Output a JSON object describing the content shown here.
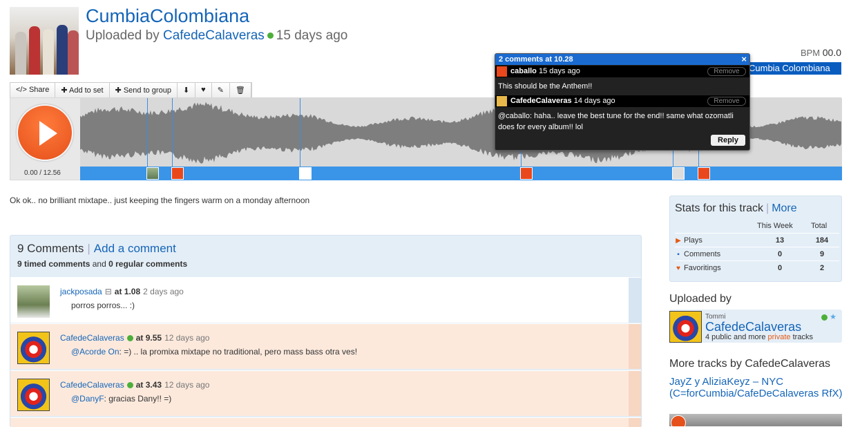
{
  "track": {
    "title": "CumbiaColombiana",
    "uploaded_prefix": "Uploaded by",
    "uploader": "CafedeCalaveras",
    "age": "15 days ago",
    "bpm_label": "BPM",
    "bpm_value": "00.0",
    "tag": "Cumbia Colombiana",
    "description": "Ok ok.. no brilliant mixtape.. just keeping the fingers warm on a monday afternoon"
  },
  "toolbar": {
    "share": "Share",
    "add_to_set": "Add to set",
    "send_to_group": "Send to group",
    "download_icon": "download-icon",
    "favorite_icon": "heart-icon",
    "edit_icon": "pencil-icon",
    "delete_icon": "trash-icon"
  },
  "player": {
    "time": "0.00 / 12.56",
    "played_fraction": 0,
    "markers": [
      0.088,
      0.121,
      0.288,
      0.578,
      0.778,
      0.811
    ]
  },
  "popup": {
    "header": "2 comments at 10.28",
    "close": "×",
    "remove_label": "Remove",
    "reply_label": "Reply",
    "items": [
      {
        "user": "caballo",
        "age": "15 days ago",
        "text": "This should be the Anthem!!"
      },
      {
        "user": "CafedeCalaveras",
        "age": "14 days ago",
        "text": "@caballo: haha.. leave the best tune for the end!! same what ozomatli does for every album!! lol"
      }
    ]
  },
  "comments": {
    "count_label": "9 Comments",
    "add_label": "Add a comment",
    "timed_count": "9 timed comments",
    "and_text": "and",
    "regular_count": "0 regular comments",
    "items": [
      {
        "user": "jackposada",
        "at_label": "at 1.08",
        "age": "2 days ago",
        "mention": "",
        "text": "porros porros... :)"
      },
      {
        "user": "CafedeCalaveras",
        "at_label": "at 9.55",
        "age": "12 days ago",
        "mention": "@Acorde On",
        "text": ": =) .. la promixa mixtape no traditional, pero mass bass otra ves!"
      },
      {
        "user": "CafedeCalaveras",
        "at_label": "at 3.43",
        "age": "12 days ago",
        "mention": "@DanyF",
        "text": ": gracias Dany!! =)"
      }
    ]
  },
  "stats": {
    "title": "Stats for this track",
    "more": "More",
    "col_week": "This Week",
    "col_total": "Total",
    "rows": [
      {
        "label": "Plays",
        "week": "13",
        "total": "184"
      },
      {
        "label": "Comments",
        "week": "0",
        "total": "9"
      },
      {
        "label": "Favoritings",
        "week": "0",
        "total": "2"
      }
    ]
  },
  "uploaded_by": {
    "heading": "Uploaded by",
    "real_name": "Tommi",
    "name": "CafedeCalaveras",
    "count_prefix": "4 public and more",
    "private": "private",
    "count_suffix": "tracks"
  },
  "more_tracks": {
    "heading": "More tracks by CafedeCalaveras",
    "track_title": "JayZ y AliziaKeyz – NYC (C=forCumbia/CafeDeCalaveras RfX)"
  }
}
